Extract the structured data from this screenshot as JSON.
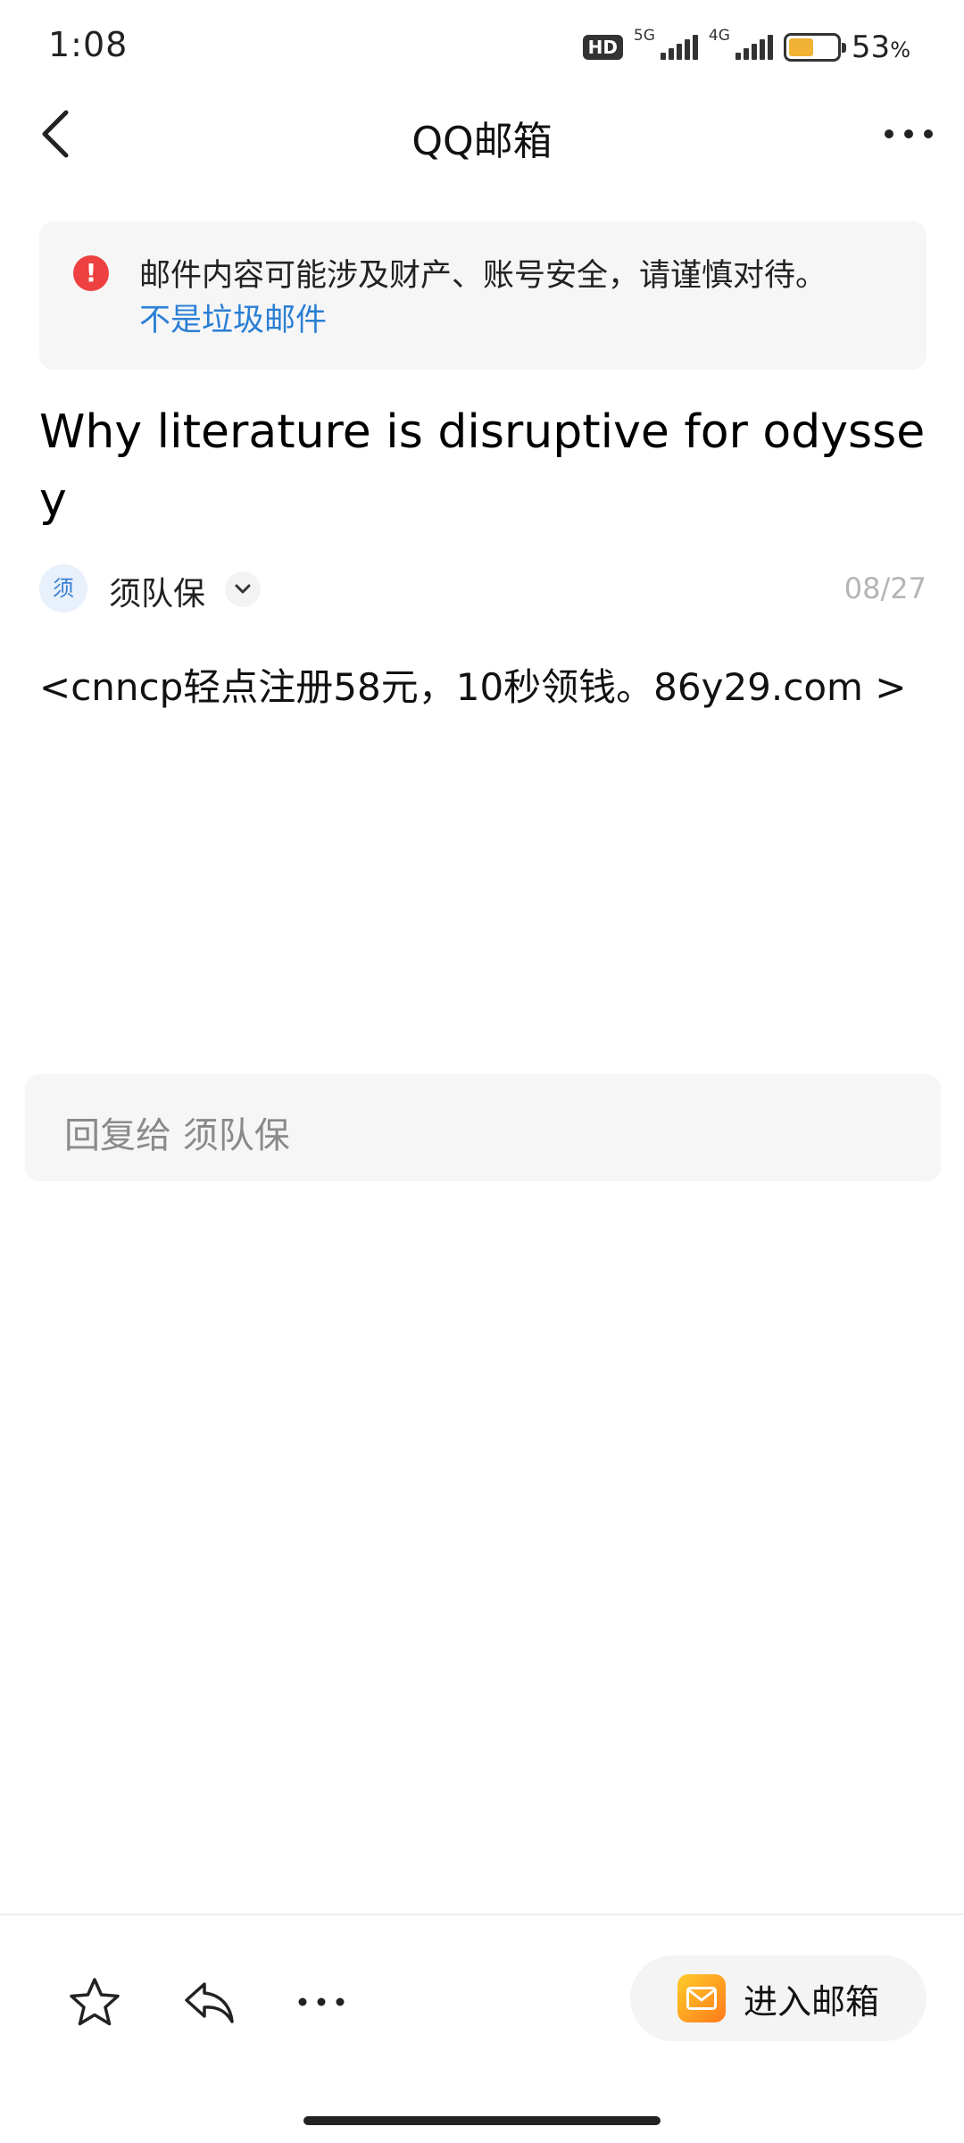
{
  "status_bar": {
    "time": "1:08",
    "hd_badge": "HD",
    "network_1": "5G",
    "network_2": "4G",
    "battery_level": 0.53,
    "battery_percent": "53",
    "battery_unit": "%"
  },
  "header": {
    "title": "QQ邮箱",
    "back_icon": "chevron-left-icon",
    "more_icon": "more-horizontal-icon"
  },
  "warning": {
    "icon_glyph": "!",
    "text": "邮件内容可能涉及财产、账号安全，请谨慎对待。",
    "link": "不是垃圾邮件"
  },
  "mail": {
    "subject": "Why literature is disruptive for odyssey",
    "sender_avatar": "须",
    "sender_name": "须队保",
    "date": "08/27",
    "body": "<cnncp轻点注册58元，10秒领钱。86y29.com >"
  },
  "reply": {
    "placeholder": "回复给 须队保"
  },
  "bottom_bar": {
    "star_icon": "star-icon",
    "reply_icon": "reply-icon",
    "more_icon": "more-horizontal-icon",
    "enter_label": "进入邮箱"
  },
  "colors": {
    "accent_link": "#2a7fd4",
    "warning_red": "#ee4040",
    "battery_fill": "#f2b233"
  }
}
